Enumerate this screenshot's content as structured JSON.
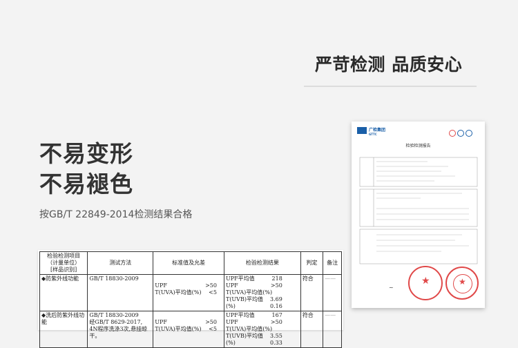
{
  "slogan": "严苛检测 品质安心",
  "headline_1": "不易变形",
  "headline_2": "不易褪色",
  "standard_note": "按GB/T 22849-2014检测结果合格",
  "report_table": {
    "headers": {
      "item": [
        "检验检测项目",
        "（计量单位）",
        "[样品识别]"
      ],
      "method": "测试方法",
      "standard": "标准值及允差",
      "result": "检验检测结果",
      "verdict": "判定",
      "remark": "备注"
    },
    "rows": [
      {
        "item": [
          "◆防紫外线功能"
        ],
        "method": [
          "GB/T 18830-2009"
        ],
        "standard_labels": [
          "UPF",
          "T(UVA)平均值(%)"
        ],
        "standard_values": [
          ">50",
          "<5"
        ],
        "result_labels": [
          "UPF平均值",
          "UPF",
          "T(UVA)平均值(%)",
          "T(UVB)平均值(%)"
        ],
        "result_values": [
          "218",
          ">50",
          "3.69",
          "0.16"
        ],
        "verdict": "符合",
        "remark": "——"
      },
      {
        "item": [
          "◆洗后防紫外线功",
          "能"
        ],
        "method": [
          "GB/T 18830-2009",
          "经GB/T 8629-2017,",
          "4N程序洗涤3次,悬挂晾",
          "干。"
        ],
        "standard_labels": [
          "UPF",
          "T(UVA)平均值(%)"
        ],
        "standard_values": [
          ">50",
          "<5"
        ],
        "result_labels": [
          "UPF平均值",
          "UPF",
          "T(UVA)平均值(%)",
          "T(UVB)平均值(%)"
        ],
        "result_values": [
          "167",
          ">50",
          "3.55",
          "0.33"
        ],
        "verdict": "符合",
        "remark": "——"
      }
    ]
  },
  "certificate": {
    "org_name": "广检集团",
    "org_en": "GTTC",
    "title": "检验检测报告",
    "seal_color": "#e04848",
    "logo_color": "#1a5fa8"
  },
  "colors": {
    "background": "#f3f3f3",
    "headline": "#333333"
  }
}
